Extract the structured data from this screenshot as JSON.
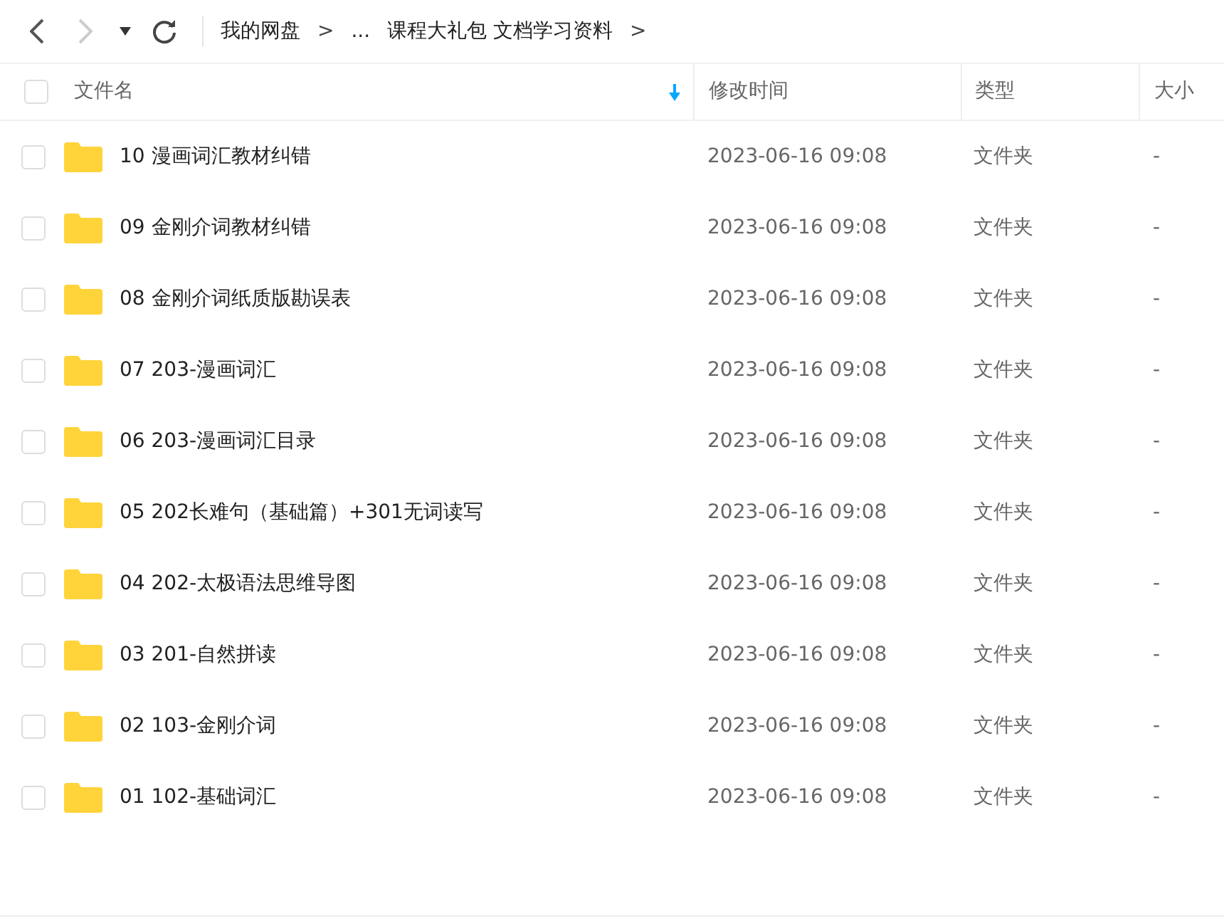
{
  "toolbar": {
    "back_disabled": false,
    "forward_disabled": true
  },
  "breadcrumb": [
    {
      "kind": "link",
      "text": "我的网盘"
    },
    {
      "kind": "sep",
      "text": ">"
    },
    {
      "kind": "link",
      "text": "..."
    },
    {
      "kind": "link",
      "text": "课程大礼包 文档学习资料"
    },
    {
      "kind": "sep",
      "text": ">"
    }
  ],
  "table": {
    "select_all": {
      "checked": false
    },
    "columns": [
      {
        "label": "文件名",
        "sorted": true
      },
      {
        "label": "修改时间",
        "sorted": false
      },
      {
        "label": "类型",
        "sorted": false
      },
      {
        "label": "大小",
        "sorted": false
      }
    ],
    "rows": [
      {
        "name": "10 漫画词汇教材纠错",
        "modified": "2023-06-16 09:08",
        "type": "文件夹",
        "size": "-",
        "checked": false
      },
      {
        "name": "09 金刚介词教材纠错",
        "modified": "2023-06-16 09:08",
        "type": "文件夹",
        "size": "-",
        "checked": false
      },
      {
        "name": "08 金刚介词纸质版勘误表",
        "modified": "2023-06-16 09:08",
        "type": "文件夹",
        "size": "-",
        "checked": false
      },
      {
        "name": "07 203-漫画词汇",
        "modified": "2023-06-16 09:08",
        "type": "文件夹",
        "size": "-",
        "checked": false
      },
      {
        "name": "06 203-漫画词汇目录",
        "modified": "2023-06-16 09:08",
        "type": "文件夹",
        "size": "-",
        "checked": false
      },
      {
        "name": "05 202长难句（基础篇）+301无词读写",
        "modified": "2023-06-16 09:08",
        "type": "文件夹",
        "size": "-",
        "checked": false
      },
      {
        "name": "04 202-太极语法思维导图",
        "modified": "2023-06-16 09:08",
        "type": "文件夹",
        "size": "-",
        "checked": false
      },
      {
        "name": "03 201-自然拼读",
        "modified": "2023-06-16 09:08",
        "type": "文件夹",
        "size": "-",
        "checked": false
      },
      {
        "name": "02 103-金刚介词",
        "modified": "2023-06-16 09:08",
        "type": "文件夹",
        "size": "-",
        "checked": false
      },
      {
        "name": "01 102-基础词汇",
        "modified": "2023-06-16 09:08",
        "type": "文件夹",
        "size": "-",
        "checked": false
      }
    ]
  }
}
